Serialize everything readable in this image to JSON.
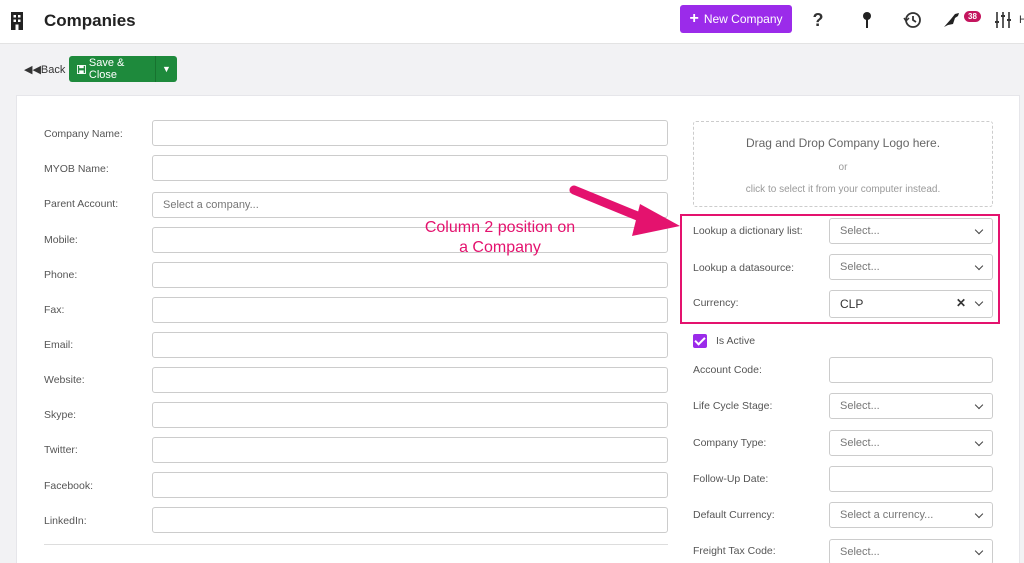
{
  "header": {
    "title": "Companies",
    "new_button": "New Company",
    "notification_count": "38",
    "user_initial": "H"
  },
  "actions": {
    "back_label": "Back",
    "save_label": "Save & Close"
  },
  "left_fields": [
    {
      "label": "Company Name:",
      "value": ""
    },
    {
      "label": "MYOB Name:",
      "value": ""
    },
    {
      "label": "Parent Account:",
      "value": "",
      "placeholder": "Select a company..."
    },
    {
      "label": "Mobile:",
      "value": ""
    },
    {
      "label": "Phone:",
      "value": ""
    },
    {
      "label": "Fax:",
      "value": ""
    },
    {
      "label": "Email:",
      "value": ""
    },
    {
      "label": "Website:",
      "value": ""
    },
    {
      "label": "Skype:",
      "value": ""
    },
    {
      "label": "Twitter:",
      "value": ""
    },
    {
      "label": "Facebook:",
      "value": ""
    },
    {
      "label": "LinkedIn:",
      "value": ""
    }
  ],
  "dropzone": {
    "title": "Drag and Drop Company Logo here.",
    "or": "or",
    "subtitle": "click to select it from your computer instead."
  },
  "right_fields": [
    {
      "label": "Lookup a dictionary list:",
      "placeholder": "Select..."
    },
    {
      "label": "Lookup a datasource:",
      "placeholder": "Select..."
    },
    {
      "label": "Currency:",
      "value": "CLP"
    }
  ],
  "is_active": {
    "label": "Is Active",
    "checked": true
  },
  "right_fields_2": [
    {
      "label": "Account Code:",
      "value": ""
    },
    {
      "label": "Life Cycle Stage:",
      "placeholder": "Select..."
    },
    {
      "label": "Company Type:",
      "placeholder": "Select..."
    },
    {
      "label": "Follow-Up Date:",
      "value": ""
    },
    {
      "label": "Default Currency:",
      "placeholder": "Select a currency..."
    },
    {
      "label": "Freight Tax Code:",
      "placeholder": "Select..."
    }
  ],
  "annotation": {
    "line1": "Column 2 position on",
    "line2": "a Company"
  },
  "colors": {
    "accent": "#9b2bea",
    "save": "#1e8a3c",
    "annotation": "#e4126e",
    "badge": "#c4155e"
  }
}
